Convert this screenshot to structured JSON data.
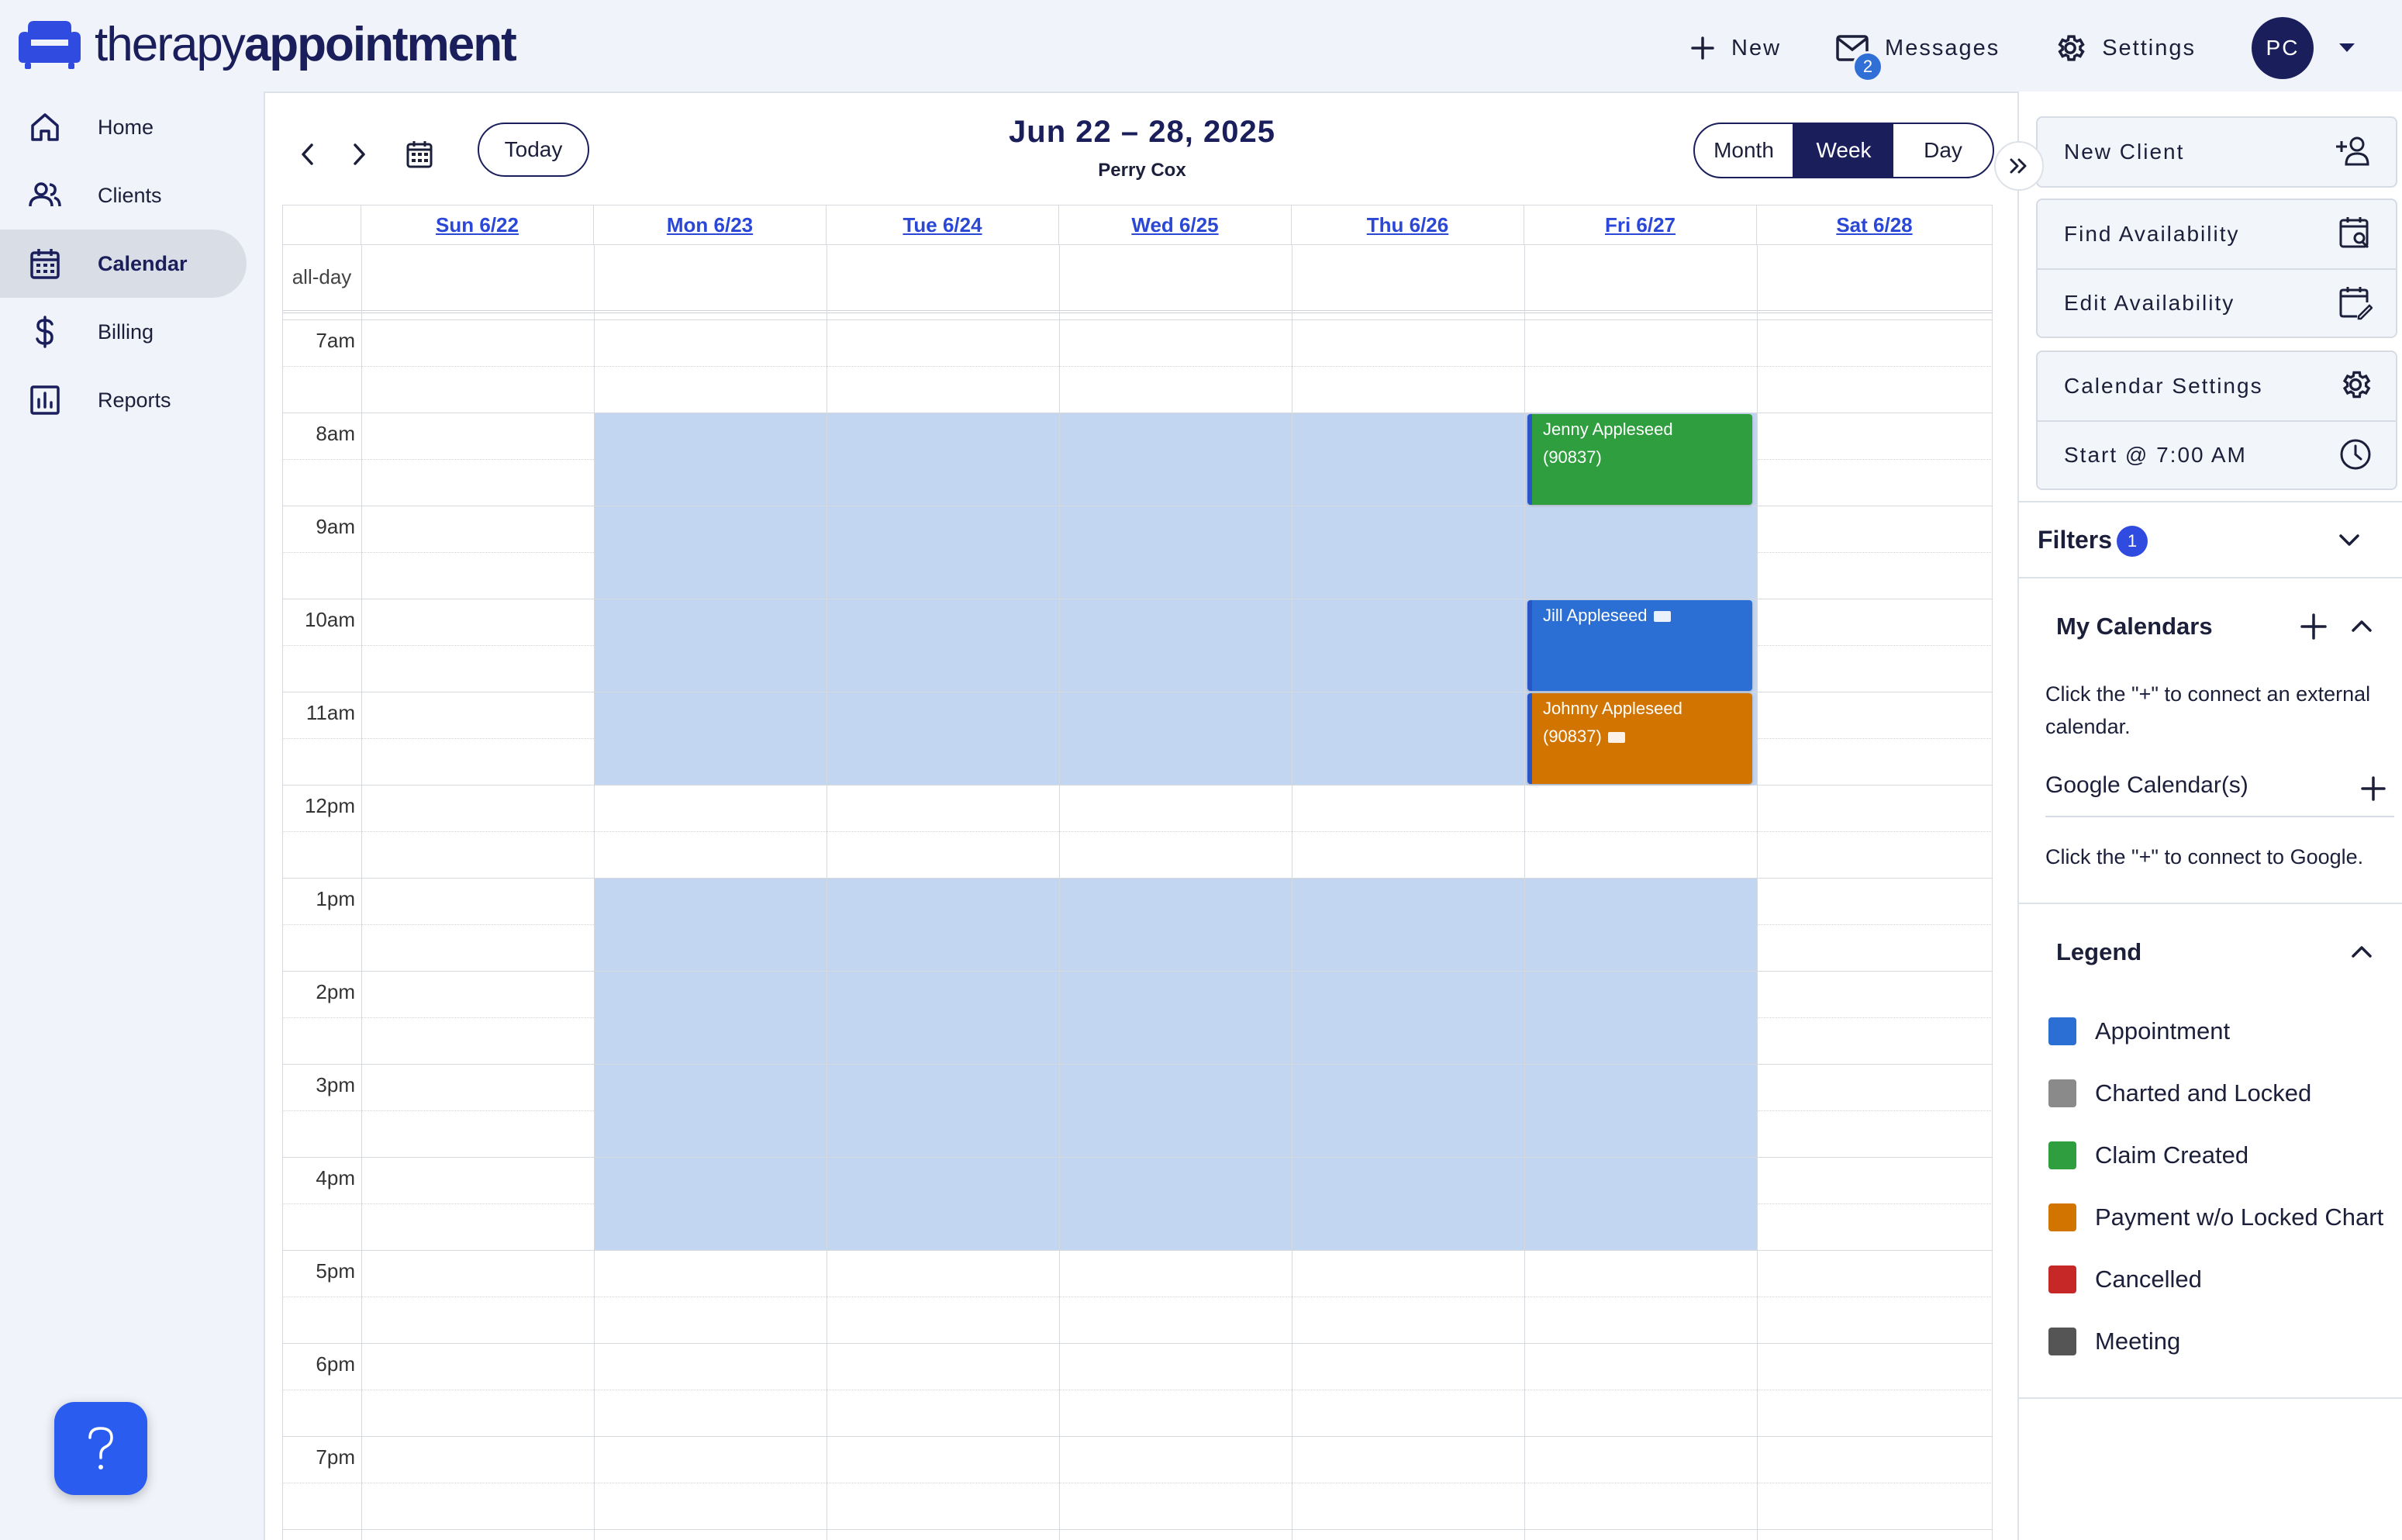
{
  "brand": {
    "name_light": "therapy",
    "name_bold": "appointment"
  },
  "topnav": {
    "new_label": "New",
    "messages_label": "Messages",
    "messages_count": "2",
    "settings_label": "Settings",
    "avatar_initials": "PC"
  },
  "sidebar": {
    "items": [
      {
        "label": "Home",
        "icon": "home-icon"
      },
      {
        "label": "Clients",
        "icon": "users-icon"
      },
      {
        "label": "Calendar",
        "icon": "calendar-icon",
        "active": true
      },
      {
        "label": "Billing",
        "icon": "dollar-icon"
      },
      {
        "label": "Reports",
        "icon": "chart-icon"
      }
    ],
    "help_icon": "question-icon"
  },
  "calendar": {
    "today_label": "Today",
    "range_title": "Jun 22 – 28, 2025",
    "provider": "Perry Cox",
    "views": {
      "month": "Month",
      "week": "Week",
      "day": "Day",
      "active": "Week"
    },
    "all_day_label": "all-day",
    "days": [
      "Sun 6/22",
      "Mon 6/23",
      "Tue 6/24",
      "Wed 6/25",
      "Thu 6/26",
      "Fri 6/27",
      "Sat 6/28"
    ],
    "times": [
      "7am",
      "8am",
      "9am",
      "10am",
      "11am",
      "12pm",
      "1pm",
      "2pm",
      "3pm",
      "4pm",
      "5pm",
      "6pm",
      "7pm"
    ],
    "availability": [
      {
        "days": [
          "Mon 6/23",
          "Tue 6/24",
          "Wed 6/25",
          "Thu 6/26",
          "Fri 6/27"
        ],
        "start": "8:00 AM",
        "end": "12:00 PM"
      },
      {
        "days": [
          "Mon 6/23",
          "Tue 6/24",
          "Wed 6/25",
          "Thu 6/26",
          "Fri 6/27"
        ],
        "start": "1:00 PM",
        "end": "5:00 PM"
      }
    ],
    "events": [
      {
        "title": "Jenny Appleseed",
        "code": "(90837)",
        "day": "Fri 6/27",
        "start": "8:00 AM",
        "end": "9:00 AM",
        "status": "Claim Created",
        "color": "#2e9e3e"
      },
      {
        "title": "Jill Appleseed",
        "code": "",
        "day": "Fri 6/27",
        "start": "10:00 AM",
        "end": "11:00 AM",
        "status": "Appointment",
        "color": "#2c6fd4",
        "has_tag": true
      },
      {
        "title": "Johnny Appleseed",
        "code": "(90837)",
        "day": "Fri 6/27",
        "start": "11:00 AM",
        "end": "12:00 PM",
        "status": "Payment w/o Locked Chart",
        "color": "#d27400",
        "has_tag": true
      }
    ]
  },
  "rightpanel": {
    "new_client": "New Client",
    "find_availability": "Find Availability",
    "edit_availability": "Edit Availability",
    "calendar_settings": "Calendar Settings",
    "start_at": "Start @ 7:00 AM",
    "filters_label": "Filters",
    "filters_count": "1",
    "my_calendars_title": "My Calendars",
    "my_calendars_text": "Click the \"+\" to connect an external calendar.",
    "google_label": "Google Calendar(s)",
    "google_text": "Click the \"+\" to connect to Google.",
    "legend_title": "Legend",
    "legend": [
      {
        "label": "Appointment",
        "color": "#2c6fd4"
      },
      {
        "label": "Charted and Locked",
        "color": "#8a8a8a"
      },
      {
        "label": "Claim Created",
        "color": "#2e9e3e"
      },
      {
        "label": "Payment w/o Locked Chart",
        "color": "#d27400"
      },
      {
        "label": "Cancelled",
        "color": "#c62828"
      },
      {
        "label": "Meeting",
        "color": "#555555"
      }
    ]
  },
  "colors": {
    "brand": "#1a1f5c",
    "accent": "#2b47d6",
    "availability": "#c2d5f1"
  }
}
